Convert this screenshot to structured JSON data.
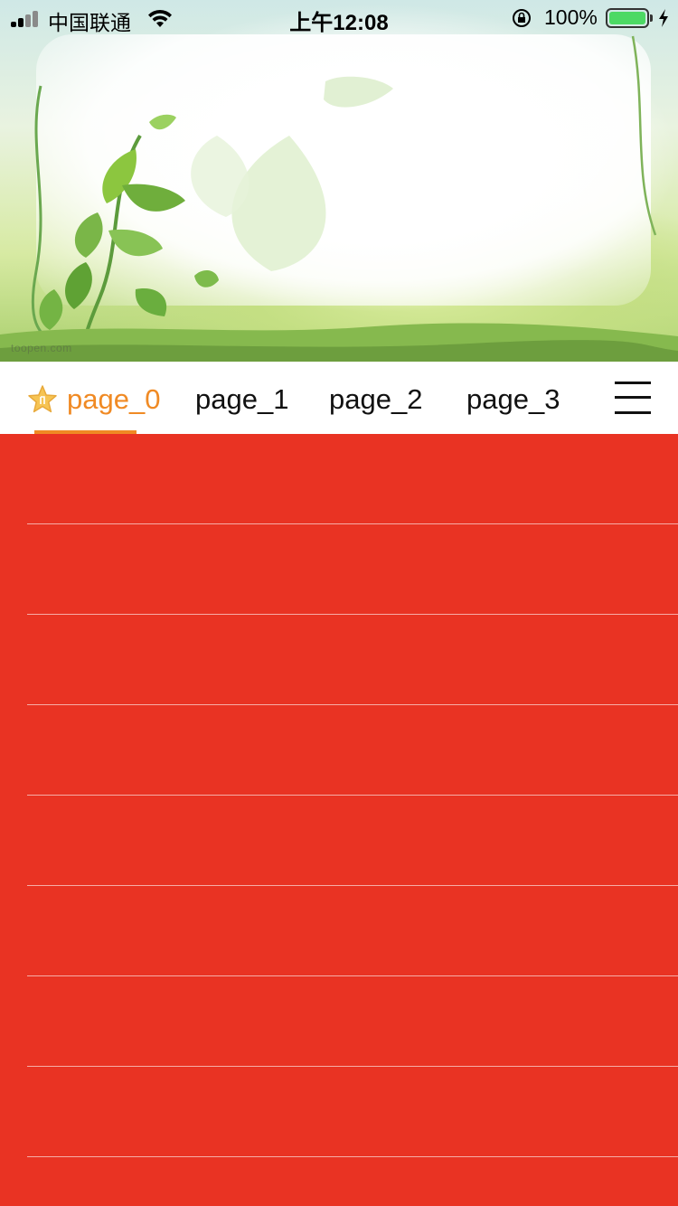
{
  "status_bar": {
    "carrier": "中国联通",
    "time": "上午12:08",
    "battery_percent": "100%",
    "battery_level": 1.0,
    "signal_bars_filled": 2,
    "signal_bars_total": 4
  },
  "hero": {
    "watermark": "toopen.com"
  },
  "tabs": [
    {
      "label": "page_0",
      "selected": true,
      "icon": "star-icon"
    },
    {
      "label": "page_1",
      "selected": false
    },
    {
      "label": "page_2",
      "selected": false
    },
    {
      "label": "page_3",
      "selected": false
    }
  ],
  "menu_icon": "hamburger-menu-icon",
  "colors": {
    "list_background": "#e93323",
    "tab_active": "#f08a24",
    "tab_inactive": "#111111",
    "divider": "#f4a69e"
  },
  "list": {
    "row_count": 8
  }
}
